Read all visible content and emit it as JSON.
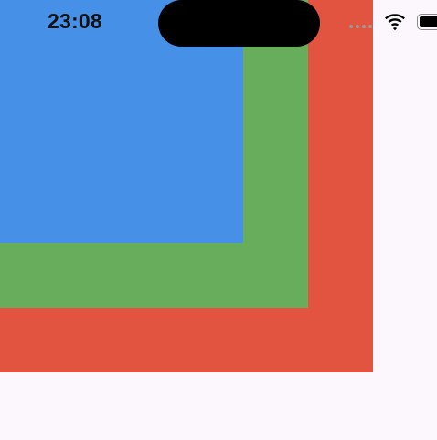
{
  "status_bar": {
    "time": "23:08",
    "signal_icon": "cellular-signal-dots",
    "wifi_icon": "wifi-icon",
    "battery_icon": "battery-icon"
  },
  "boxes": {
    "outer_color": "#e25440",
    "middle_color": "#67ad5b",
    "inner_color": "#4690e8"
  },
  "colors": {
    "background": "#fcf7fd",
    "island": "#000000"
  }
}
